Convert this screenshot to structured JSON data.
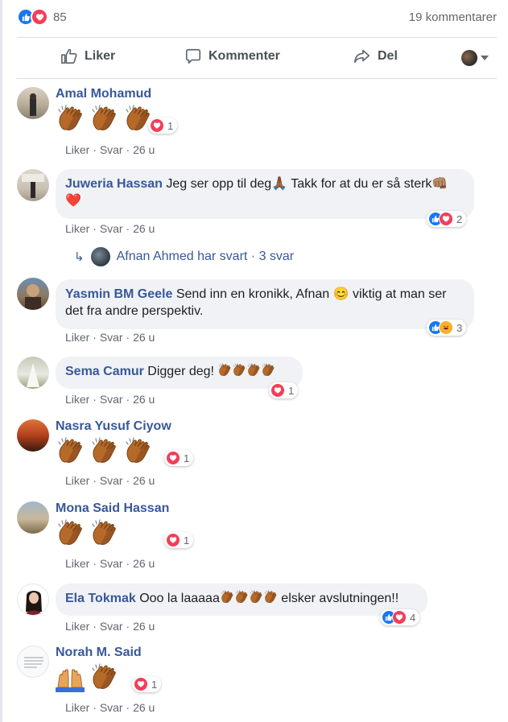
{
  "summary": {
    "reactions": [
      "like-reaction",
      "love-reaction"
    ],
    "count": "85",
    "comments_label": "19 kommentarer"
  },
  "actions": {
    "like_label": "Liker",
    "comment_label": "Kommenter",
    "share_label": "Del"
  },
  "meta_labels": {
    "like": "Liker",
    "dot": " · ",
    "reply": "Svar"
  },
  "comments": [
    {
      "name": "Amal Mohamud",
      "text": "",
      "emoji": [
        "clapping-hands",
        "clapping-hands",
        "clapping-hands"
      ],
      "reactions": [
        "love"
      ],
      "reaction_count": "1",
      "time": "26 u"
    },
    {
      "name": "Juweria Hassan",
      "text": "Jeg ser opp til deg🙏🏾 Takk for at du er så sterk👊🏽 ❤️",
      "reactions": [
        "like",
        "love"
      ],
      "reaction_count": "2",
      "time": "26 u"
    },
    {
      "name": "Yasmin BM Geele",
      "text": "Send inn en kronikk, Afnan 😊 viktig at man ser det fra andre perspektiv.",
      "reactions": [
        "like",
        "haha"
      ],
      "reaction_count": "3",
      "time": "26 u"
    },
    {
      "name": "Sema Camur",
      "text": "Digger deg!",
      "emoji": [
        "clapping-hands",
        "clapping-hands",
        "clapping-hands",
        "clapping-hands"
      ],
      "reactions": [
        "love"
      ],
      "reaction_count": "1",
      "time": "26 u"
    },
    {
      "name": "Nasra Yusuf Ciyow",
      "text": "",
      "emoji": [
        "clapping-hands",
        "clapping-hands",
        "clapping-hands"
      ],
      "reactions": [
        "love"
      ],
      "reaction_count": "1",
      "time": "26 u"
    },
    {
      "name": "Mona Said Hassan",
      "text": "",
      "emoji": [
        "clapping-hands",
        "clapping-hands"
      ],
      "reactions": [
        "love"
      ],
      "reaction_count": "1",
      "time": "26 u"
    },
    {
      "name": "Ela Tokmak",
      "text_before": "Ooo la laaaaa",
      "text_after": " elsker avslutningen!!",
      "emoji": [
        "clapping-hands",
        "clapping-hands",
        "clapping-hands",
        "clapping-hands"
      ],
      "reactions": [
        "like",
        "love"
      ],
      "reaction_count": "4",
      "time": "26 u"
    },
    {
      "name": "Norah M. Said",
      "text": "",
      "emoji": [
        "raising-hands",
        "clapping-hands"
      ],
      "reactions": [
        "love"
      ],
      "reaction_count": "1",
      "time": "26 u"
    }
  ],
  "reply_thread": {
    "text": "Afnan Ahmed har svart",
    "sep": " · ",
    "count": "3 svar"
  },
  "colors": {
    "link": "#385898",
    "like": "#1877f2",
    "love": "#f33e58",
    "bubble": "#f0f2f5"
  }
}
